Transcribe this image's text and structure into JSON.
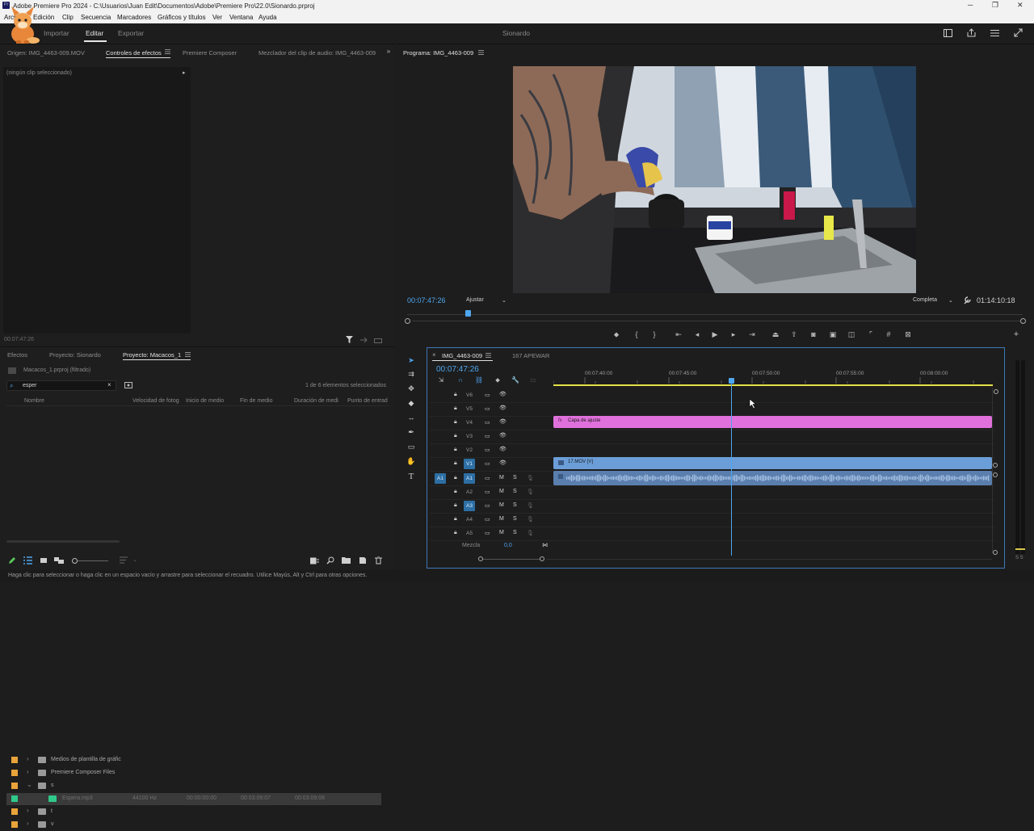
{
  "window": {
    "title": "Adobe Premiere Pro 2024 - C:\\Usuarios\\Juan Edit\\Documentos\\Adobe\\Premiere Pro\\22.0\\Sionardo.prproj",
    "minimize": "─",
    "maximize": "❐",
    "close": "✕"
  },
  "menu": [
    "Archivo",
    "Edición",
    "Clip",
    "Secuencia",
    "Marcadores",
    "Gráficos y títulos",
    "Ver",
    "Ventana",
    "Ayuda"
  ],
  "workspace": {
    "tabs": [
      "Inicio",
      "Importar",
      "Editar",
      "Exportar"
    ],
    "active": "Editar",
    "project_name": "Sionardo"
  },
  "source_panel": {
    "tabs": [
      "Origen: IMG_4463-009.MOV",
      "Controles de efectos",
      "Premiere Composer",
      "Mezclador del clip de audio: IMG_4463-009"
    ],
    "active_tab": "Controles de efectos",
    "no_clip": "(ningún clip seleccionado)",
    "timecode": "00:07:47:26"
  },
  "program_panel": {
    "title": "Programa: IMG_4463-009",
    "timecode": "00:07:47:26",
    "zoom": "Ajustar",
    "quality": "Completa",
    "duration": "01:14:10:18"
  },
  "project_panel": {
    "tabs": [
      "Efectos",
      "Proyecto: Sionardo",
      "Proyecto: Macacos_1"
    ],
    "active_tab": "Proyecto: Macacos_1",
    "path": "Macacos_1.prproj (filtrado)",
    "search_value": "esper",
    "selection_info": "1 de 6 elementos seleccionados",
    "columns": [
      "Nombre",
      "Velocidad de fotog",
      "Inicio de medio",
      "Fin de medio",
      "Duración de medi",
      "Punto de entrad"
    ],
    "rows": [
      {
        "name": "Medios de plantilla de gráfic",
        "rate": "",
        "start": "",
        "end": "",
        "duration": "",
        "color": "#e8a33a",
        "type": "folder",
        "indent": 0
      },
      {
        "name": "Premiere Composer Files",
        "rate": "",
        "start": "",
        "end": "",
        "duration": "",
        "color": "#e8a33a",
        "type": "folder",
        "indent": 0
      },
      {
        "name": "s",
        "rate": "",
        "start": "",
        "end": "",
        "duration": "",
        "color": "#e8a33a",
        "type": "folder",
        "indent": 0
      },
      {
        "name": "Espera.mp3",
        "rate": "44100 Hz",
        "start": "00:00:00:00",
        "end": "00:03:09:07",
        "duration": "00:03:09:08",
        "color": "#2fc98a",
        "type": "audio",
        "indent": 1
      },
      {
        "name": "t",
        "rate": "",
        "start": "",
        "end": "",
        "duration": "",
        "color": "#e8a33a",
        "type": "folder",
        "indent": 0
      },
      {
        "name": "v",
        "rate": "",
        "start": "",
        "end": "",
        "duration": "",
        "color": "#e8a33a",
        "type": "folder",
        "indent": 0
      }
    ]
  },
  "timeline": {
    "tabs": [
      "IMG_4463-009",
      "167 APEWAR"
    ],
    "timecode": "00:07:47:26",
    "ruler": [
      "00:07:40:00",
      "00:07:45:00",
      "00:07:50:00",
      "00:07:55:00",
      "00:08:00:00"
    ],
    "video_tracks": [
      "V6",
      "V5",
      "V4",
      "V3",
      "V2",
      "V1"
    ],
    "audio_tracks": [
      "A1",
      "A2",
      "A3",
      "A4",
      "A5"
    ],
    "source_patch": "A1",
    "mix_label": "Mezcla",
    "mix_value": "0,0",
    "mute": "M",
    "solo": "S",
    "clips": {
      "adjustment": "Capa de ajuste",
      "video": "17.MOV [V]"
    }
  },
  "audio_meter": {
    "labels": "S S"
  },
  "status": "Haga clic para seleccionar o haga clic en un espacio vacío y arrastre para seleccionar el recuadro. Utilice Mayús, Alt y Ctrl para otras opciones.",
  "colors": {
    "accent": "#4ea6ef",
    "adjustment_clip": "#e070dc",
    "video_clip": "#6b9ed8",
    "audio_clip": "#5a7fae",
    "playhead": "#4ea6ef"
  }
}
